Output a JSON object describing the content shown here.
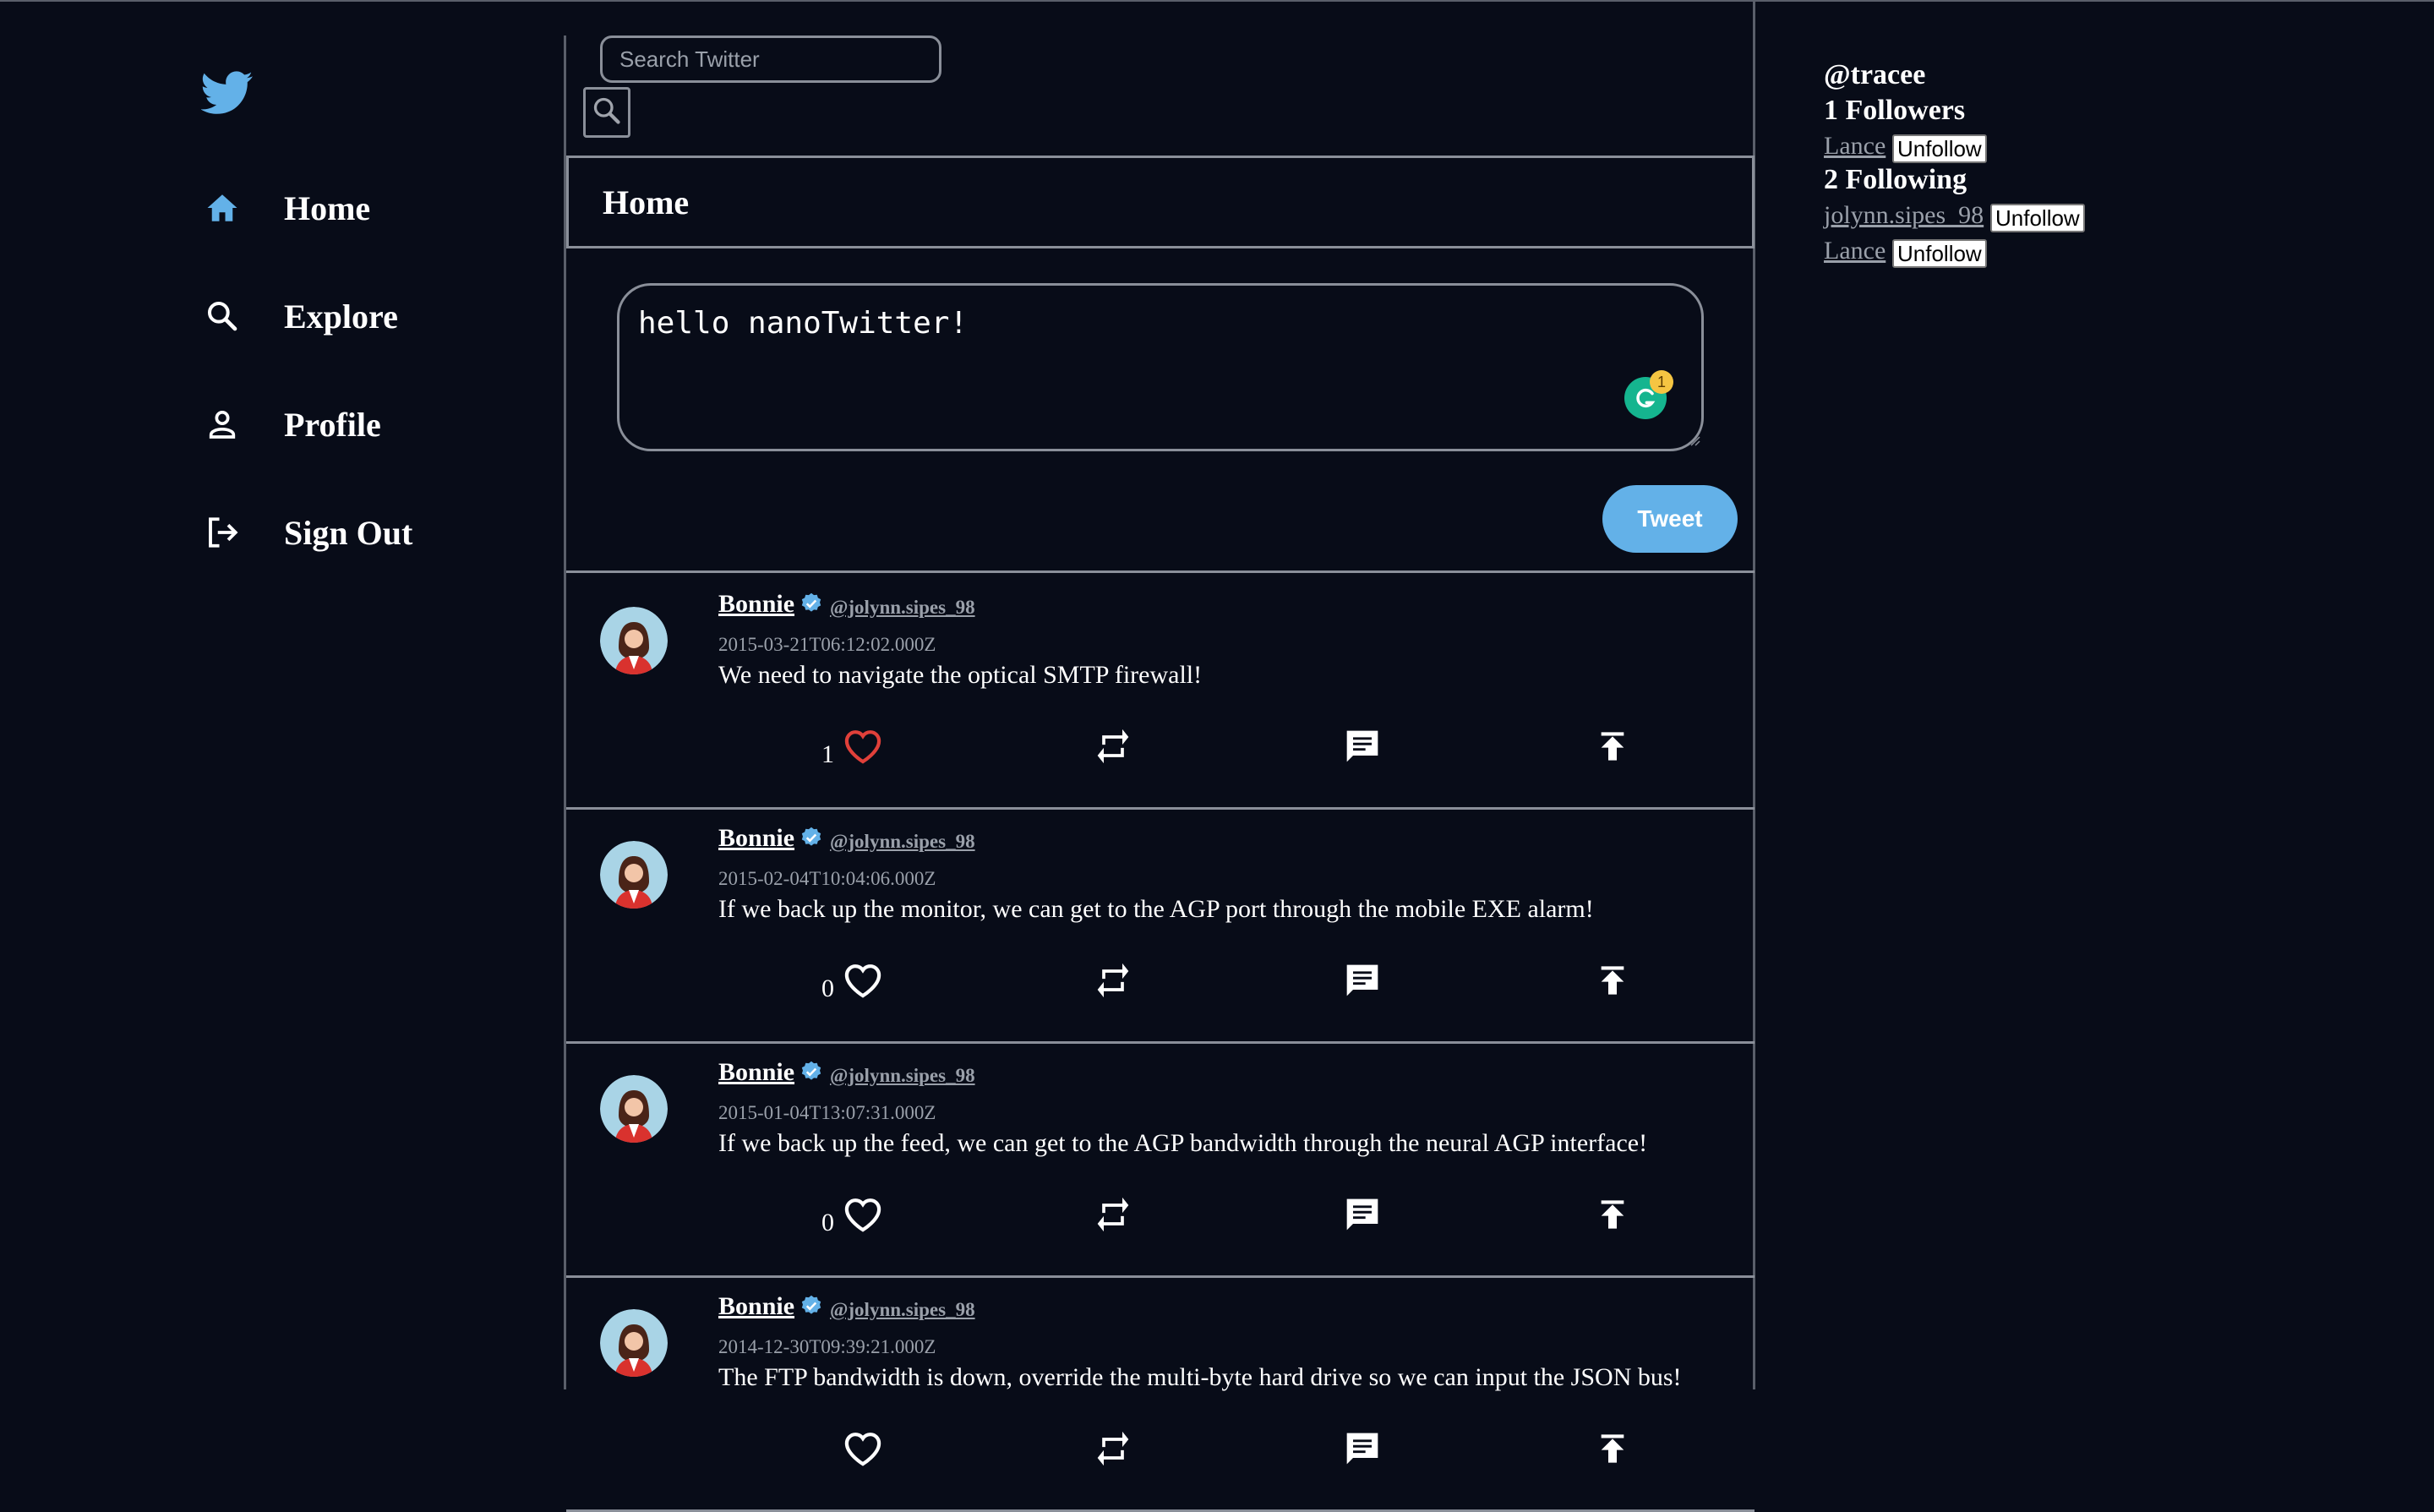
{
  "nav": {
    "items": [
      {
        "label": "Home",
        "icon": "home-icon"
      },
      {
        "label": "Explore",
        "icon": "search-icon"
      },
      {
        "label": "Profile",
        "icon": "person-icon"
      },
      {
        "label": "Sign Out",
        "icon": "sign-out-icon"
      }
    ]
  },
  "search": {
    "placeholder": "Search Twitter"
  },
  "header": {
    "title": "Home"
  },
  "compose": {
    "text": "hello nanoTwitter!",
    "button_label": "Tweet",
    "grammarly_count": "1"
  },
  "tweets": [
    {
      "name": "Bonnie",
      "handle": "@jolynn.sipes_98",
      "date": "2015-03-21T06:12:02.000Z",
      "text": "We need to navigate the optical SMTP firewall!",
      "likes": "1",
      "liked": true
    },
    {
      "name": "Bonnie",
      "handle": "@jolynn.sipes_98",
      "date": "2015-02-04T10:04:06.000Z",
      "text": "If we back up the monitor, we can get to the AGP port through the mobile EXE alarm!",
      "likes": "0",
      "liked": false
    },
    {
      "name": "Bonnie",
      "handle": "@jolynn.sipes_98",
      "date": "2015-01-04T13:07:31.000Z",
      "text": "If we back up the feed, we can get to the AGP bandwidth through the neural AGP interface!",
      "likes": "0",
      "liked": false
    },
    {
      "name": "Bonnie",
      "handle": "@jolynn.sipes_98",
      "date": "2014-12-30T09:39:21.000Z",
      "text": "The FTP bandwidth is down, override the multi-byte hard drive so we can input the JSON bus!",
      "likes": "",
      "liked": false
    }
  ],
  "profile": {
    "username": "@tracee",
    "followers_title": "1 Followers",
    "followers": [
      {
        "name": "Lance",
        "button": "Unfollow"
      }
    ],
    "following_title": "2 Following",
    "following": [
      {
        "name": "jolynn.sipes_98",
        "button": "Unfollow"
      },
      {
        "name": "Lance",
        "button": "Unfollow"
      }
    ]
  },
  "colors": {
    "background": "#080c18",
    "accent": "#63b1e8",
    "like_active": "#e0403a",
    "verified": "#63b1e8",
    "muted_text": "#9aa0aa"
  }
}
